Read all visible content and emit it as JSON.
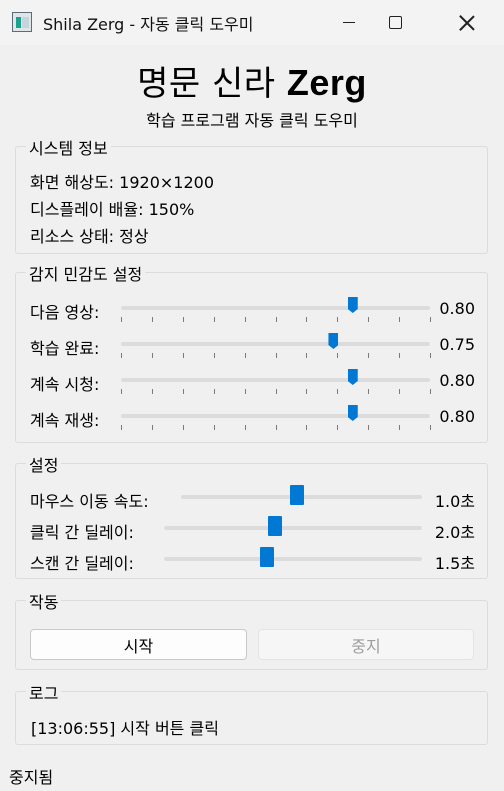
{
  "window": {
    "title": "Shila Zerg - 자동 클릭 도우미"
  },
  "header": {
    "title_main": "명문 신라 ",
    "title_bold": "Zerg",
    "subtitle": "학습 프로그램 자동 클릭 도우미"
  },
  "system_info": {
    "title": "시스템 정보",
    "resolution": "화면 해상도: 1920×1200",
    "scale": "디스플레이 배율: 150%",
    "resource": "리소스 상태: 정상"
  },
  "sensitivity": {
    "title": "감지 민감도 설정",
    "items": [
      {
        "label": "다음 영상:",
        "value_text": "0.80",
        "value": 0.8
      },
      {
        "label": "학습 완료:",
        "value_text": "0.75",
        "value": 0.75
      },
      {
        "label": "계속 시청:",
        "value_text": "0.80",
        "value": 0.8
      },
      {
        "label": "계속 재생:",
        "value_text": "0.80",
        "value": 0.8
      }
    ]
  },
  "settings": {
    "title": "설정",
    "items": [
      {
        "label": "마우스 이동 속도:",
        "value_text": "1.0초",
        "value": 0.48
      },
      {
        "label": "클릭 간 딜레이:",
        "value_text": "2.0초",
        "value": 0.43
      },
      {
        "label": "스캔 간 딜레이:",
        "value_text": "1.5초",
        "value": 0.4
      }
    ]
  },
  "actions": {
    "title": "작동",
    "start_label": "시작",
    "stop_label": "중지"
  },
  "log": {
    "title": "로그",
    "entries": [
      "[13:06:55] 시작 버튼 클릭"
    ]
  },
  "status": {
    "text": "중지됨"
  },
  "colors": {
    "accent": "#0078d4"
  }
}
